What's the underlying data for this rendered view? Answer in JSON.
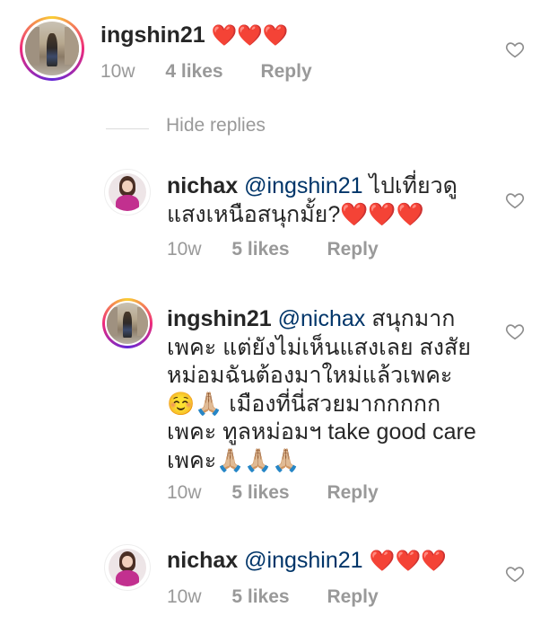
{
  "comments": [
    {
      "username": "ingshin21",
      "mention": "",
      "lines": [
        "❤️❤️❤️"
      ],
      "time": "10w",
      "likes": "4 likes",
      "reply": "Reply"
    },
    {
      "username": "nichax",
      "mention": "@ingshin21",
      "lines": [
        " ไปเที่ยวดู",
        "แสงเหนือสนุกมั้ย?❤️❤️❤️"
      ],
      "time": "10w",
      "likes": "5 likes",
      "reply": "Reply"
    },
    {
      "username": "ingshin21",
      "mention": "@nichax",
      "lines": [
        " สนุกมาก",
        "เพคะ แต่ยังไม่เห็นแสงเลย สงสัย",
        "หม่อมฉันต้องมาใหม่แล้วเพคะ",
        "☺️🙏🏼 เมืองที่นี่สวยมากกกกก",
        "เพคะ ทูลหม่อมฯ take good care",
        "เพคะ🙏🏼🙏🏼🙏🏼"
      ],
      "time": "10w",
      "likes": "5 likes",
      "reply": "Reply"
    },
    {
      "username": "nichax",
      "mention": "@ingshin21",
      "lines": [
        " ❤️❤️❤️"
      ],
      "time": "10w",
      "likes": "5 likes",
      "reply": "Reply"
    }
  ],
  "hide_replies": "Hide replies",
  "icons": {
    "like": "heart-outline-icon",
    "avatar_ingshin": "avatar-city-photo",
    "avatar_nichax": "avatar-woman-photo"
  },
  "colors": {
    "mention": "#003569",
    "meta": "#999999",
    "heart_emoji": "#e0202b"
  }
}
